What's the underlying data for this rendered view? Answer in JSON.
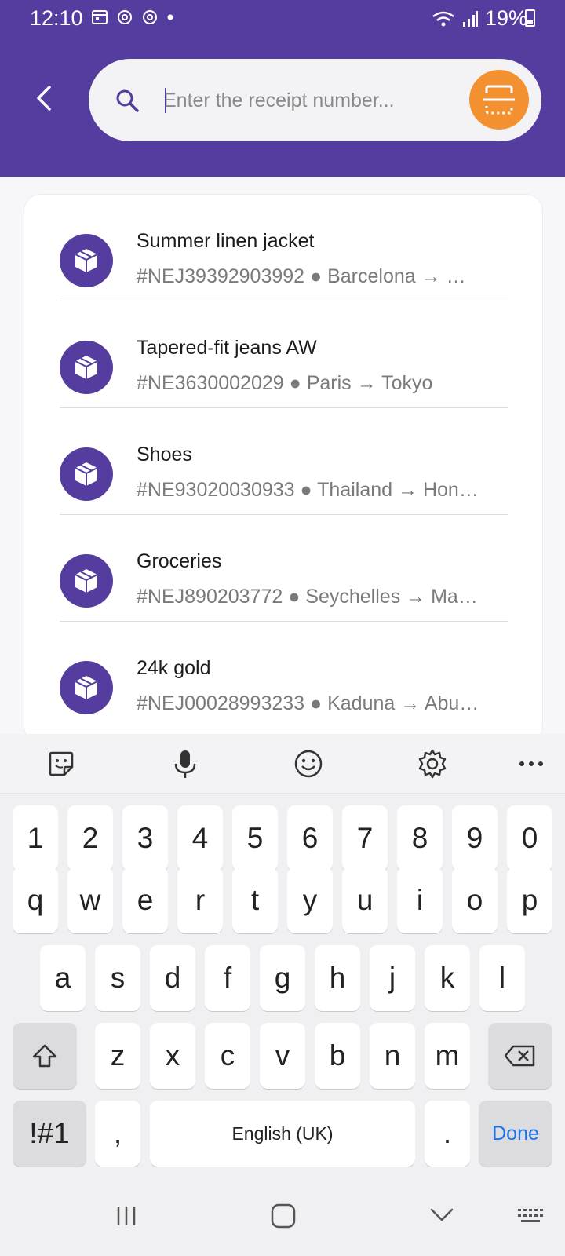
{
  "status_bar": {
    "time": "12:10",
    "battery": "19%"
  },
  "search": {
    "placeholder": "Enter the receipt number..."
  },
  "colors": {
    "brand": "#553d9f",
    "accent": "#f39131"
  },
  "shipments": [
    {
      "title": "Summer linen jacket",
      "receipt": "#NEJ39392903992",
      "origin": "Barcelona",
      "destination": "…"
    },
    {
      "title": "Tapered-fit jeans AW",
      "receipt": "#NE3630002029",
      "origin": "Paris",
      "destination": "Tokyo"
    },
    {
      "title": "Shoes",
      "receipt": "#NE93020030933",
      "origin": "Thailand",
      "destination": "Hon…"
    },
    {
      "title": "Groceries",
      "receipt": "#NEJ890203772",
      "origin": "Seychelles",
      "destination": "Ma…"
    },
    {
      "title": "24k gold",
      "receipt": "#NEJ00028993233",
      "origin": "Kaduna",
      "destination": "Abu…"
    }
  ],
  "keyboard": {
    "row_numbers": [
      "1",
      "2",
      "3",
      "4",
      "5",
      "6",
      "7",
      "8",
      "9",
      "0"
    ],
    "row_1": [
      "q",
      "w",
      "e",
      "r",
      "t",
      "y",
      "u",
      "i",
      "o",
      "p"
    ],
    "row_2": [
      "a",
      "s",
      "d",
      "f",
      "g",
      "h",
      "j",
      "k",
      "l"
    ],
    "row_3": [
      "z",
      "x",
      "c",
      "v",
      "b",
      "n",
      "m"
    ],
    "symbols_key": "!#1",
    "comma_key": ",",
    "space_label": "English (UK)",
    "period_key": ".",
    "done_label": "Done"
  }
}
